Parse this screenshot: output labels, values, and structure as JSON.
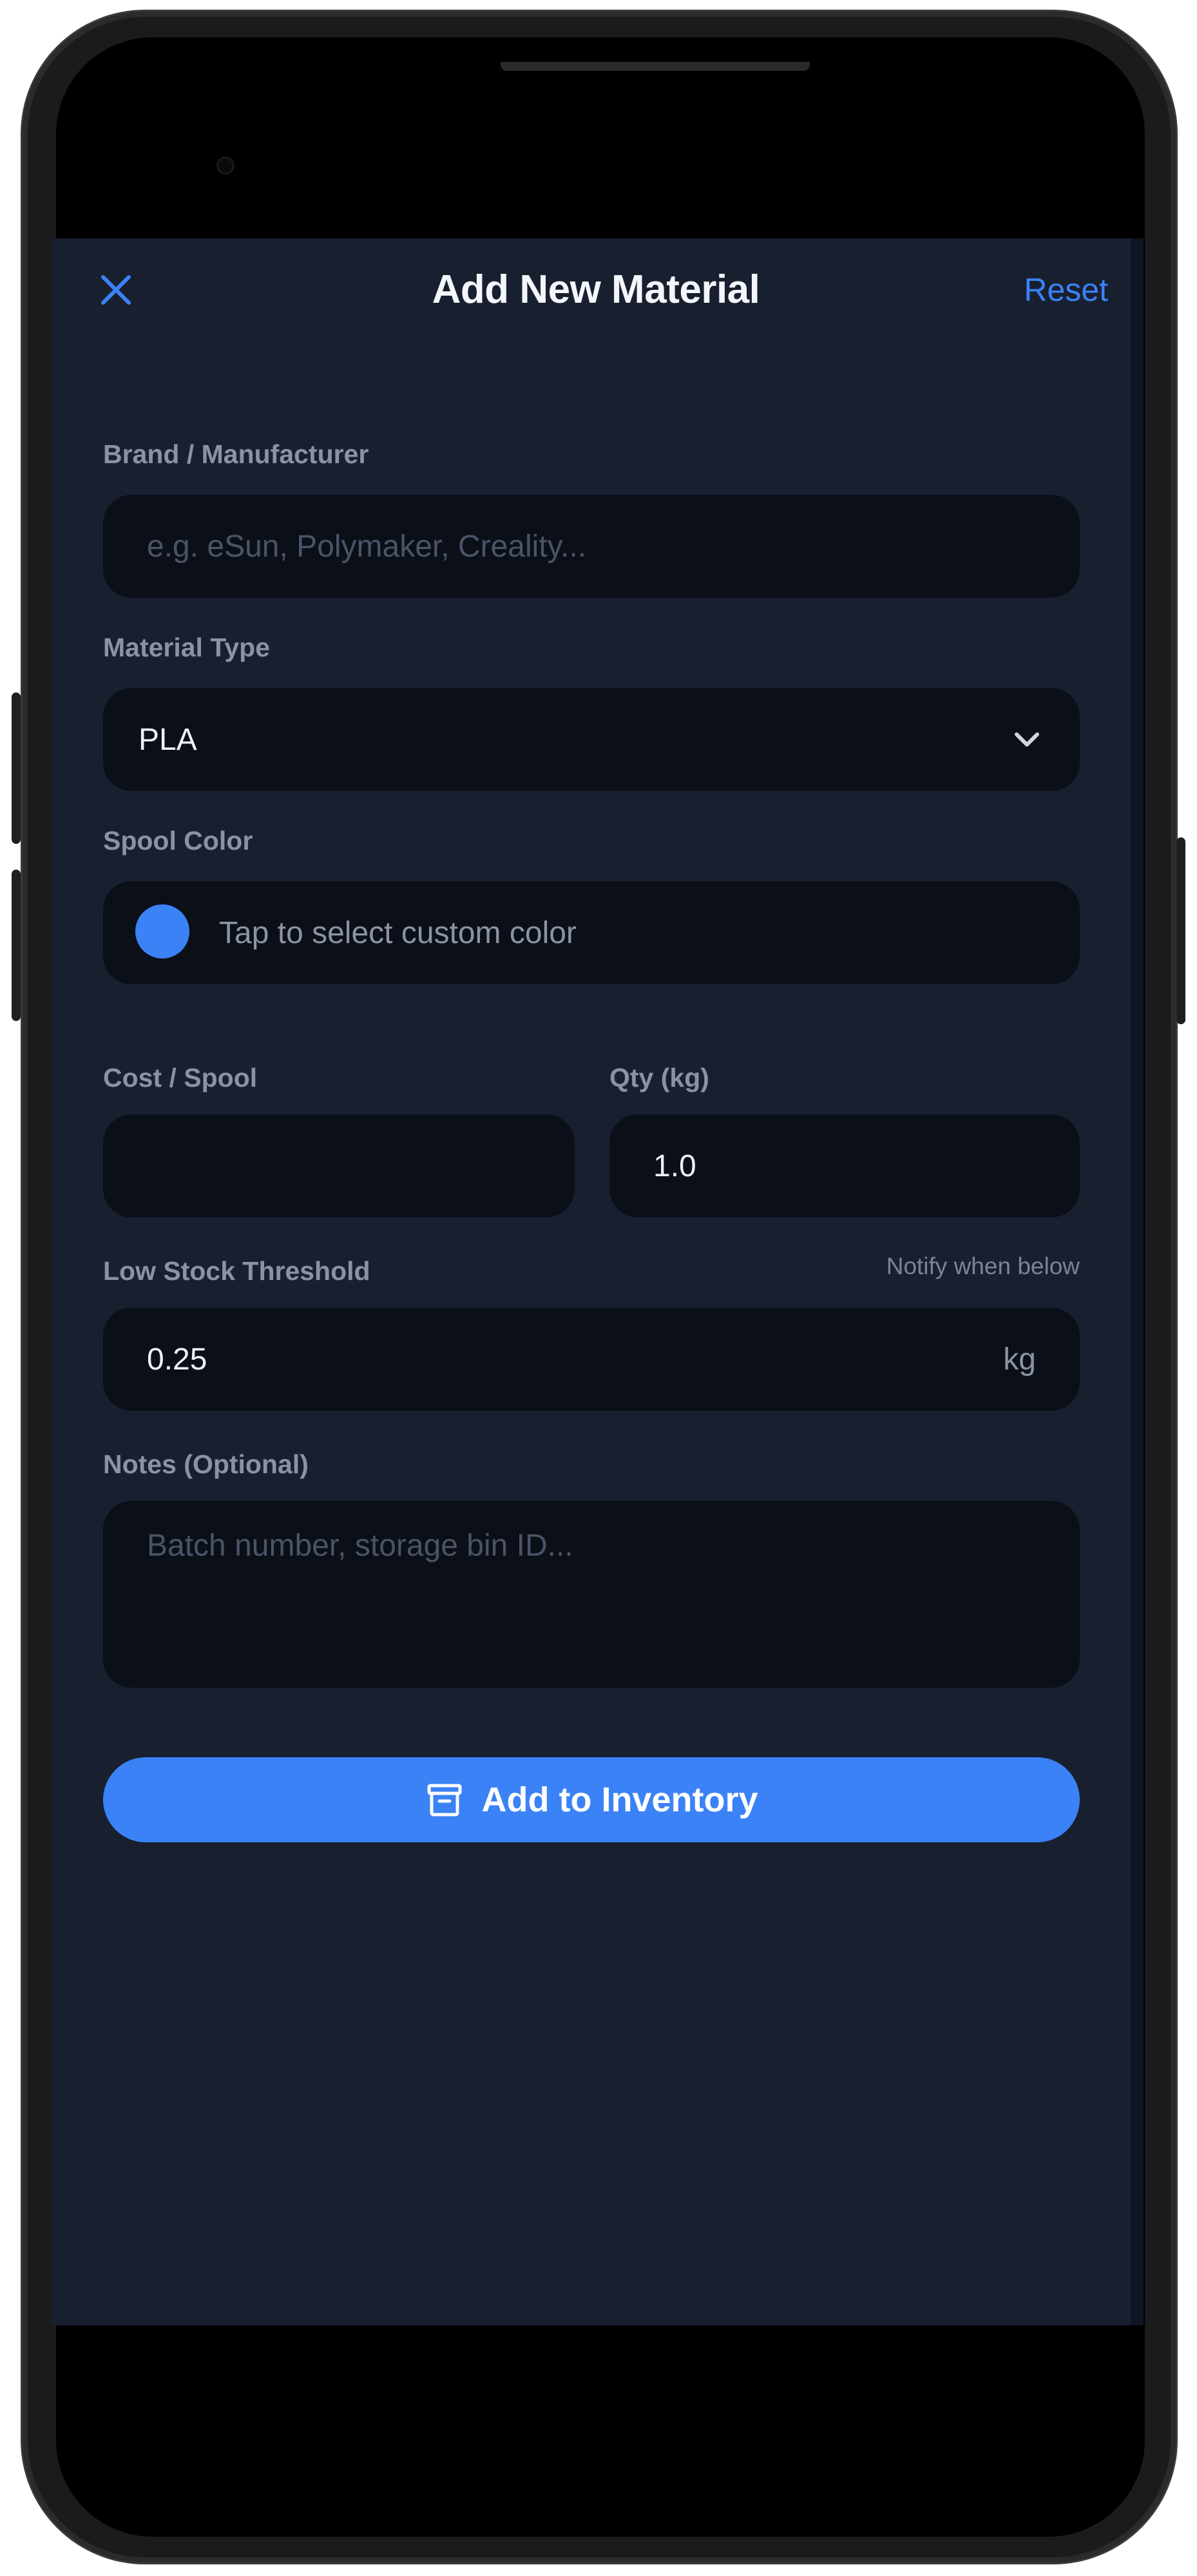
{
  "header": {
    "title": "Add New Material",
    "reset_label": "Reset"
  },
  "form": {
    "brand": {
      "label": "Brand / Manufacturer",
      "placeholder": "e.g. eSun, Polymaker, Creality..."
    },
    "material_type": {
      "label": "Material Type",
      "selected": "PLA"
    },
    "spool_color": {
      "label": "Spool Color",
      "text": "Tap to select custom color",
      "color": "#3b82f6"
    },
    "cost": {
      "label": "Cost / Spool",
      "value": ""
    },
    "qty": {
      "label": "Qty (kg)",
      "value": "1.0"
    },
    "low_stock": {
      "label": "Low Stock Threshold",
      "hint": "Notify when below",
      "value": "0.25",
      "unit": "kg"
    },
    "notes": {
      "label": "Notes (Optional)",
      "placeholder": "Batch number, storage bin ID..."
    }
  },
  "submit": {
    "label": "Add to Inventory"
  },
  "colors": {
    "accent": "#3b82f6",
    "background": "#182030",
    "field": "#0b0f18"
  }
}
